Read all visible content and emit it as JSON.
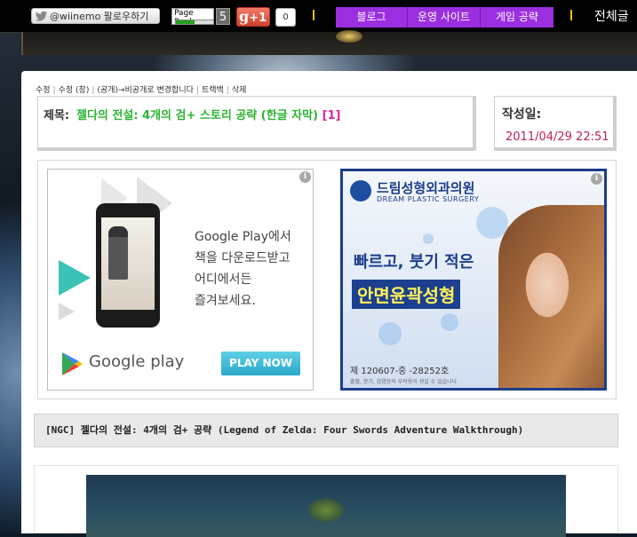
{
  "topbar": {
    "twitter_label": "@wiinemo 팔로우하기",
    "pagerank_label": "Page Rank",
    "pagerank_value": "5",
    "gplus_label": "+1",
    "gplus_count": "0",
    "nav": [
      "블로그",
      "운영 사이트",
      "게임 공략"
    ],
    "right_text": "전체글"
  },
  "post": {
    "meta_links": [
      "수정",
      "수정 (창)",
      "(공개)→비공개로 변경합니다",
      "트랙백",
      "삭제"
    ],
    "title_label": "제목:",
    "title": "젤다의 전설: 4개의 검+ 스토리 공략 (한글 자막)",
    "comment_count": "[1]",
    "date_label": "작성일:",
    "date": "2011/04/29 22:51",
    "subtitle": "[NGC] 젤다의 전설: 4개의 검+ 공략 (Legend of Zelda: Four Swords Adventure Walkthrough)"
  },
  "ads": {
    "ad1": {
      "text_lines": [
        "Google Play에서",
        "책을 다운로드받고",
        "어디에서든",
        "즐겨보세요."
      ],
      "brand": "Google play",
      "cta": "PLAY NOW"
    },
    "ad2": {
      "clinic_name": "드림성형외과의원",
      "clinic_en": "DREAM PLASTIC SURGERY",
      "line1": "빠르고, 붓기 적은",
      "line2": "안면윤곽성형",
      "registration": "제 120607-중 -28252호",
      "warning": "출혈, 붓기, 감염등의 부작용이 생길 수 있습니다"
    }
  },
  "colors": {
    "nav_bg": "#9b2fe0",
    "title_green": "#2bb432",
    "date_red": "#c0224f",
    "count_pink": "#e0299a"
  }
}
